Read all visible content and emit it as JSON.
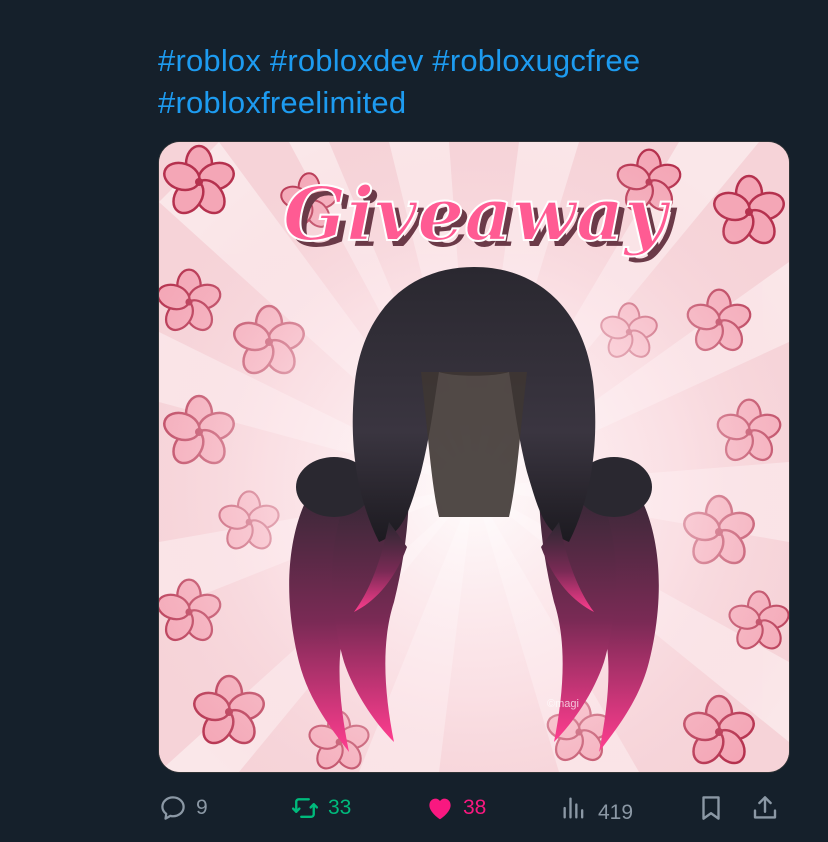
{
  "tweet": {
    "hashtags": [
      "#roblox",
      "#robloxdev",
      "#robloxugcfree",
      "#robloxfreelimited"
    ]
  },
  "media": {
    "title_text": "Giveaway",
    "watermark": "©magi",
    "colors": {
      "background": "#f6d3d8",
      "flower": "#f4a6b6",
      "flower_outline": "#b5314e",
      "title": "#ff5b93",
      "hair": "#1f1d24",
      "hair_tips": "#ff3d8f"
    }
  },
  "actions": {
    "reply": {
      "count": "9",
      "icon": "reply-icon"
    },
    "retweet": {
      "count": "33",
      "icon": "retweet-icon",
      "color": "#00ba7c"
    },
    "like": {
      "count": "38",
      "icon": "heart-icon",
      "color": "#f91880"
    },
    "views": {
      "count": "419",
      "icon": "views-icon"
    },
    "bookmark": {
      "icon": "bookmark-icon"
    },
    "share": {
      "icon": "share-icon"
    }
  },
  "theme": {
    "background": "#15202b",
    "link": "#1d9bf0",
    "muted": "#8b98a5"
  }
}
